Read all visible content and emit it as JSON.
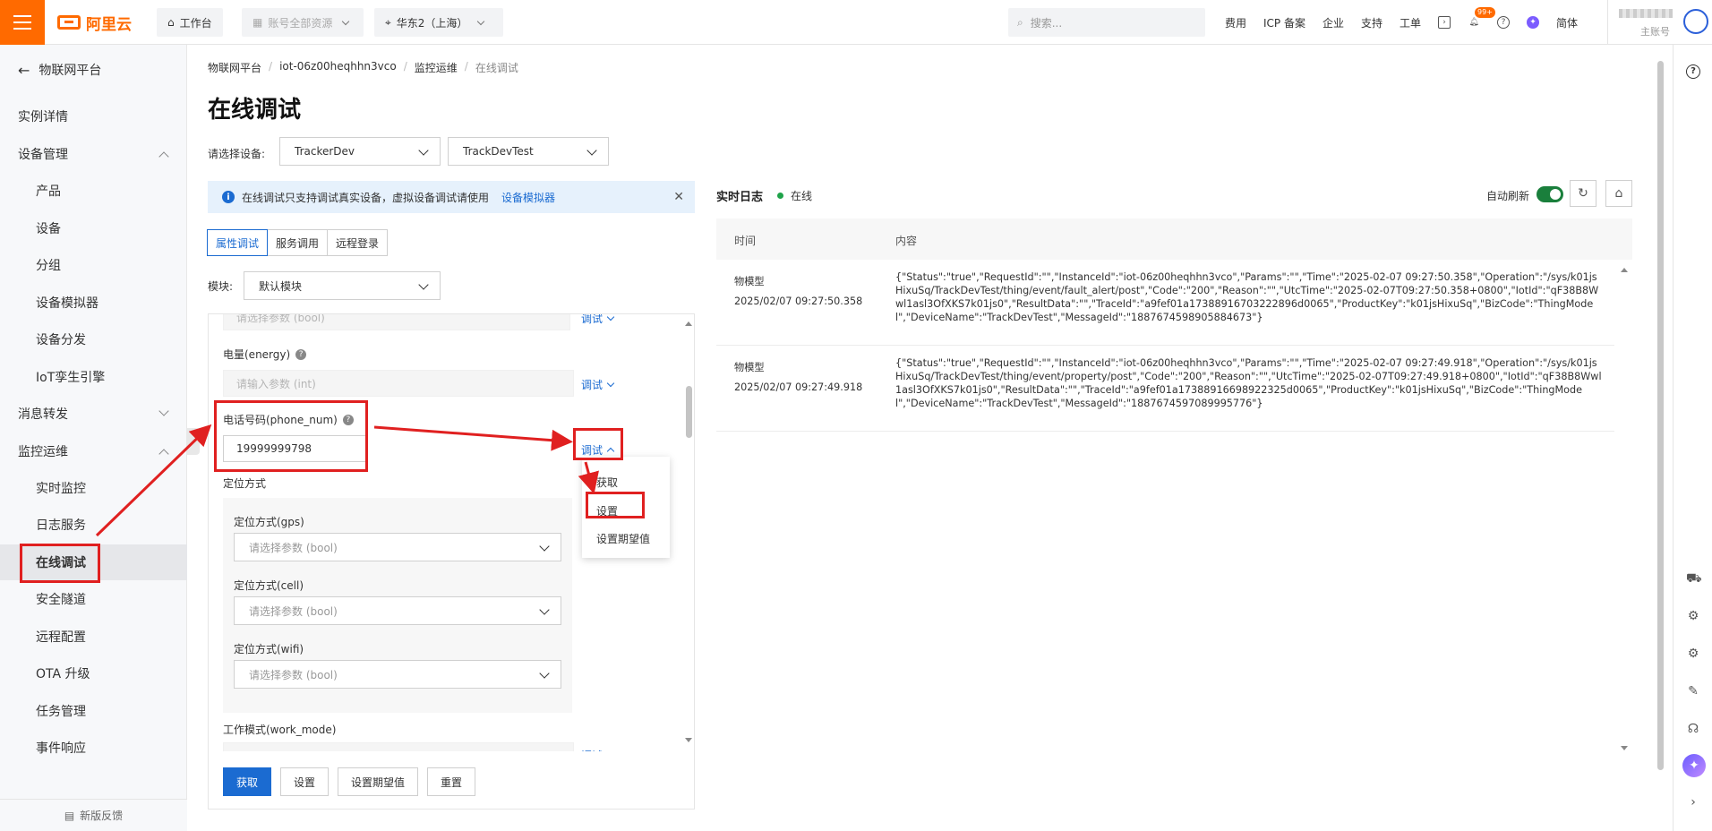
{
  "topbar": {
    "logo_text": "阿里云",
    "workbench": "工作台",
    "account_resources": "账号全部资源",
    "region": "华东2（上海）",
    "search_placeholder": "搜索...",
    "links": [
      "费用",
      "ICP 备案",
      "企业",
      "支持",
      "工单"
    ],
    "notification_badge": "99+",
    "lang": "简体",
    "account_sub": "主账号"
  },
  "sidebar": {
    "back_label": "物联网平台",
    "items": [
      {
        "label": "实例详情"
      },
      {
        "label": "设备管理"
      },
      {
        "label": "产品"
      },
      {
        "label": "设备"
      },
      {
        "label": "分组"
      },
      {
        "label": "设备模拟器"
      },
      {
        "label": "设备分发"
      },
      {
        "label": "IoT孪生引擎"
      },
      {
        "label": "消息转发"
      },
      {
        "label": "监控运维"
      },
      {
        "label": "实时监控"
      },
      {
        "label": "日志服务"
      },
      {
        "label": "在线调试"
      },
      {
        "label": "安全隧道"
      },
      {
        "label": "远程配置"
      },
      {
        "label": "OTA 升级"
      },
      {
        "label": "任务管理"
      },
      {
        "label": "事件响应"
      }
    ],
    "feedback": "新版反馈"
  },
  "breadcrumb": [
    "物联网平台",
    "iot-06z00heqhhn3vco",
    "监控运维",
    "在线调试"
  ],
  "page_title": "在线调试",
  "device_select": {
    "label": "请选择设备:",
    "product": "TrackerDev",
    "device": "TrackDevTest"
  },
  "notice": {
    "text": "在线调试只支持调试真实设备，虚拟设备调试请使用",
    "link": "设备模拟器"
  },
  "tabs": [
    "属性调试",
    "服务调用",
    "远程登录"
  ],
  "module": {
    "label": "模块:",
    "value": "默认模块"
  },
  "properties": {
    "top_partial_placeholder": "请选择参数 (bool)",
    "energy_label": "电量(energy)",
    "energy_placeholder": "请输入参数 (int)",
    "phone_label": "电话号码(phone_num)",
    "phone_value": "19999999798",
    "location_label": "定位方式",
    "gps_label": "定位方式(gps)",
    "cell_label": "定位方式(cell)",
    "wifi_label": "定位方式(wifi)",
    "bool_placeholder": "请选择参数 (bool)",
    "work_mode_label": "工作模式(work_mode)",
    "debug_label": "调试"
  },
  "dropdown": [
    "获取",
    "设置",
    "设置期望值"
  ],
  "buttons": {
    "get": "获取",
    "set": "设置",
    "set_expected": "设置期望值",
    "reset": "重置"
  },
  "log": {
    "title": "实时日志",
    "status": "在线",
    "auto_refresh": "自动刷新",
    "col_time": "时间",
    "col_content": "内容",
    "rows": [
      {
        "type": "物模型",
        "time": "2025/02/07 09:27:50.358",
        "content": "{\"Status\":\"true\",\"RequestId\":\"\",\"InstanceId\":\"iot-06z00heqhhn3vco\",\"Params\":\"\",\"Time\":\"2025-02-07 09:27:50.358\",\"Operation\":\"/sys/k01jsHixuSq/TrackDevTest/thing/event/fault_alert/post\",\"Code\":\"200\",\"Reason\":\"\",\"UtcTime\":\"2025-02-07T09:27:50.358+0800\",\"IotId\":\"qF38B8Wwl1asl3OfXKS7k01js0\",\"ResultData\":\"\",\"TraceId\":\"a9fef01a17388916703222896d0065\",\"ProductKey\":\"k01jsHixuSq\",\"BizCode\":\"ThingModel\",\"DeviceName\":\"TrackDevTest\",\"MessageId\":\"1887674598905884673\"}"
      },
      {
        "type": "物模型",
        "time": "2025/02/07 09:27:49.918",
        "content": "{\"Status\":\"true\",\"RequestId\":\"\",\"InstanceId\":\"iot-06z00heqhhn3vco\",\"Params\":\"\",\"Time\":\"2025-02-07 09:27:49.918\",\"Operation\":\"/sys/k01jsHixuSq/TrackDevTest/thing/event/property/post\",\"Code\":\"200\",\"Reason\":\"\",\"UtcTime\":\"2025-02-07T09:27:49.918+0800\",\"IotId\":\"qF38B8Wwl1asl3OfXKS7k01js0\",\"ResultData\":\"\",\"TraceId\":\"a9fef01a17388916698922325d0065\",\"ProductKey\":\"k01jsHixuSq\",\"BizCode\":\"ThingModel\",\"DeviceName\":\"TrackDevTest\",\"MessageId\":\"1887674597089995776\"}"
      }
    ]
  },
  "colors": {
    "brand": "#ff6a00",
    "primary": "#1b6bd1",
    "annotation": "#e02020",
    "online": "#1fa34a"
  }
}
